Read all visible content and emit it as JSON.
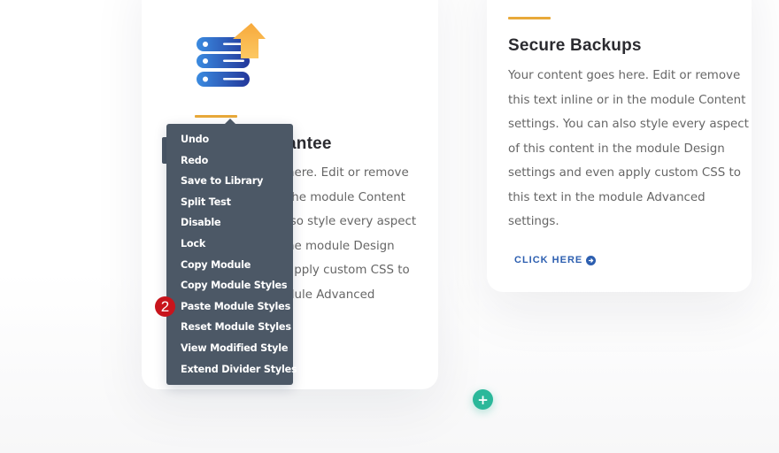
{
  "left_card": {
    "title_visible": "antee",
    "body_lines_visible": [
      "here. Edit or remove",
      "the module Content",
      "lso style every aspect",
      "he module Design",
      "apply custom CSS to",
      "dule Advanced"
    ],
    "icon": "server-upload-icon"
  },
  "right_card": {
    "title": "Secure Backups",
    "body_lines": [
      "Your content goes here. Edit or remove",
      "this text inline or in the module Content",
      "settings. You can also style every aspect",
      "of this content in the module Design",
      "settings and even apply custom CSS to",
      "this text in the module Advanced",
      "settings."
    ],
    "link_label": "CLICK HERE",
    "link_icon": "arrow-circle-right-icon"
  },
  "context_menu": {
    "items": [
      "Undo",
      "Redo",
      "Save to Library",
      "Split Test",
      "Disable",
      "Lock",
      "Copy Module",
      "Copy Module Styles",
      "Paste Module Styles",
      "Reset Module Styles",
      "View Modified Style",
      "Extend Divider Styles"
    ]
  },
  "step_badge": {
    "label": "2",
    "color": "#c8141c"
  },
  "add_button": {
    "label": "+",
    "color": "#2bb89a"
  },
  "colors": {
    "accent_divider": "#e8a93a",
    "menu_bg": "#4c5866",
    "link": "#2d5fb0"
  }
}
